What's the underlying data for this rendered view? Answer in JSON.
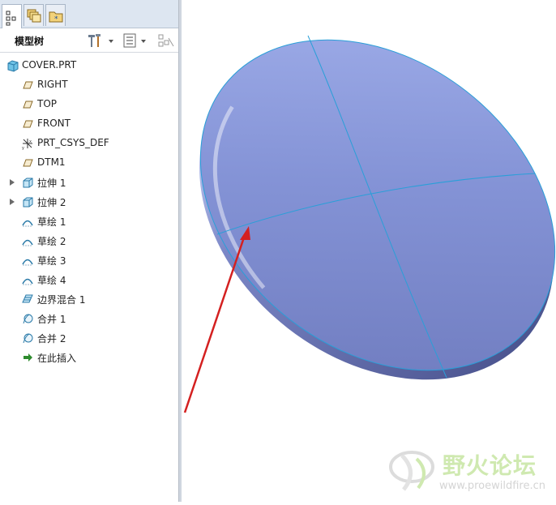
{
  "panel": {
    "title": "模型树",
    "tabs": [
      "model-tree-tab",
      "layers-tab",
      "folder-tab"
    ]
  },
  "tree": {
    "root": "COVER.PRT",
    "items": [
      {
        "label": "RIGHT",
        "icon": "datum-plane-icon",
        "expandable": false
      },
      {
        "label": "TOP",
        "icon": "datum-plane-icon",
        "expandable": false
      },
      {
        "label": "FRONT",
        "icon": "datum-plane-icon",
        "expandable": false
      },
      {
        "label": "PRT_CSYS_DEF",
        "icon": "csys-icon",
        "expandable": false
      },
      {
        "label": "DTM1",
        "icon": "datum-plane-icon",
        "expandable": false
      },
      {
        "label": "拉伸 1",
        "icon": "extrude-icon",
        "expandable": true
      },
      {
        "label": "拉伸 2",
        "icon": "extrude-icon",
        "expandable": true
      },
      {
        "label": "草绘 1",
        "icon": "sketch-icon",
        "expandable": false
      },
      {
        "label": "草绘 2",
        "icon": "sketch-icon",
        "expandable": false
      },
      {
        "label": "草绘 3",
        "icon": "sketch-icon",
        "expandable": false
      },
      {
        "label": "草绘 4",
        "icon": "sketch-icon",
        "expandable": false
      },
      {
        "label": "边界混合 1",
        "icon": "boundary-blend-icon",
        "expandable": false
      },
      {
        "label": "合并 1",
        "icon": "merge-icon",
        "expandable": false
      },
      {
        "label": "合并 2",
        "icon": "merge-icon",
        "expandable": false
      },
      {
        "label": "在此插入",
        "icon": "insert-here-icon",
        "expandable": false
      }
    ]
  },
  "watermark": {
    "name": "野火论坛",
    "url": "www.proewildfire.cn"
  },
  "colors": {
    "model_fill": "#7f8fcc",
    "edge_line": "#2a9fd8",
    "arrow": "#d42020",
    "tab_bar": "#dde6f1"
  }
}
